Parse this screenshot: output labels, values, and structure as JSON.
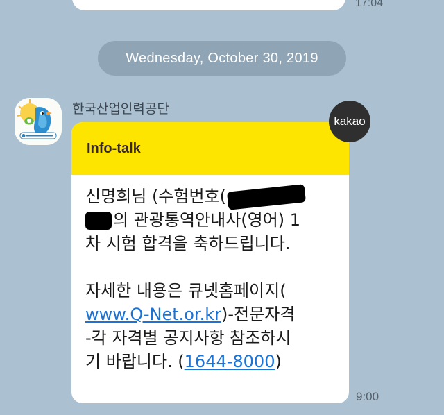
{
  "previous_message": {
    "time": "17:04"
  },
  "date_divider": "Wednesday, October 30, 2019",
  "sender": {
    "name": "한국산업인력공단",
    "avatar_icon": "hrdk-mascot-logo-icon"
  },
  "badge": "kakao",
  "card": {
    "header": "Info-talk",
    "header_color": "#fee500",
    "body": {
      "line1_start": "신명희님 (수험번호(",
      "line2_end": "의 관광통역안내사(영어) 1",
      "line3": "차 시험 합격을 축하드립니다.",
      "line4": "자세한 내용은 큐넷홈페이지(",
      "link_url": "www.Q-Net.or.kr",
      "line5_end": ")-전문자격",
      "line6": "-각 자격별 공지사항 참조하시",
      "line7_start": "기 바랍니다. (",
      "phone": "1644-8000",
      "line7_end": ")"
    }
  },
  "message_time": "9:00"
}
